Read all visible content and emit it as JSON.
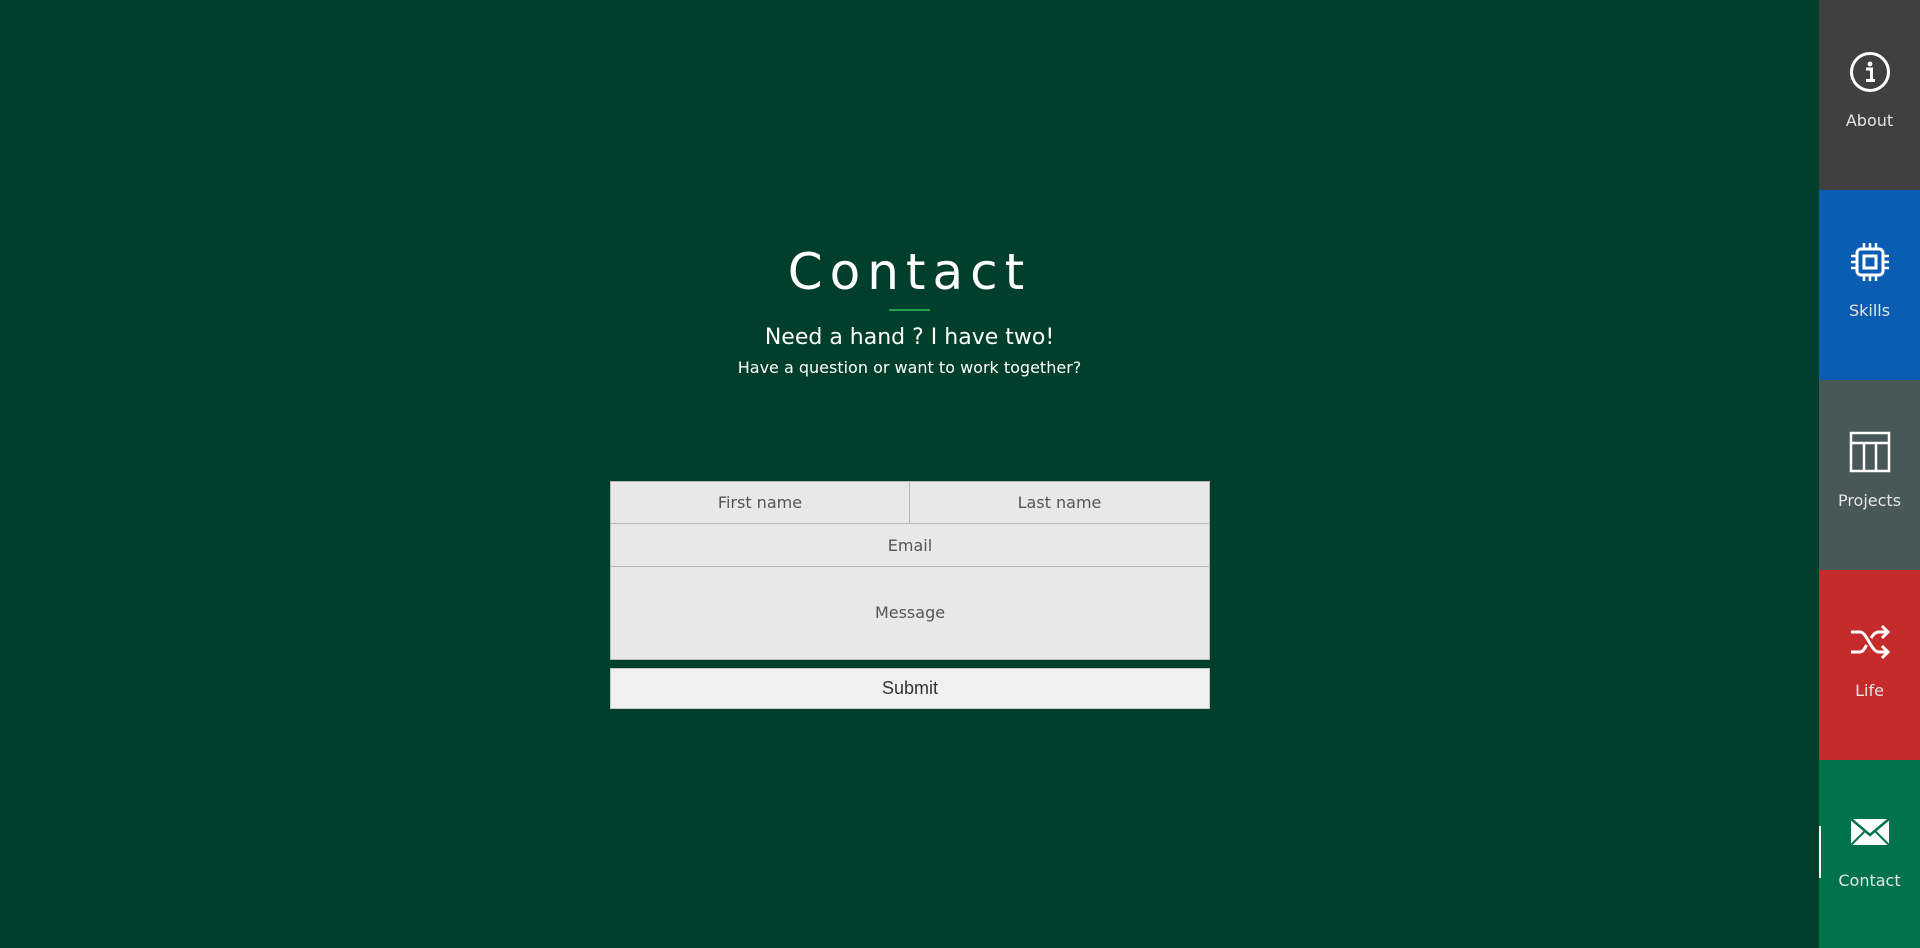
{
  "contact": {
    "title": "Contact",
    "subtitle": "Need a hand ? I have two!",
    "tagline": "Have a question or want to work together?",
    "accent_color": "#1ea34a"
  },
  "form": {
    "first_name_placeholder": "First name",
    "last_name_placeholder": "Last name",
    "email_placeholder": "Email",
    "message_placeholder": "Message",
    "submit_label": "Submit"
  },
  "nav": {
    "active": "Contact",
    "items": [
      {
        "label": "About",
        "icon": "info-icon",
        "color": "#404040"
      },
      {
        "label": "Skills",
        "icon": "chip-icon",
        "color": "#0b5db3"
      },
      {
        "label": "Projects",
        "icon": "layout-icon",
        "color": "#485757"
      },
      {
        "label": "Life",
        "icon": "shuffle-icon",
        "color": "#c62b2b"
      },
      {
        "label": "Contact",
        "icon": "envelope-icon",
        "color": "#00734d"
      }
    ]
  },
  "background_color": "#003f2b"
}
